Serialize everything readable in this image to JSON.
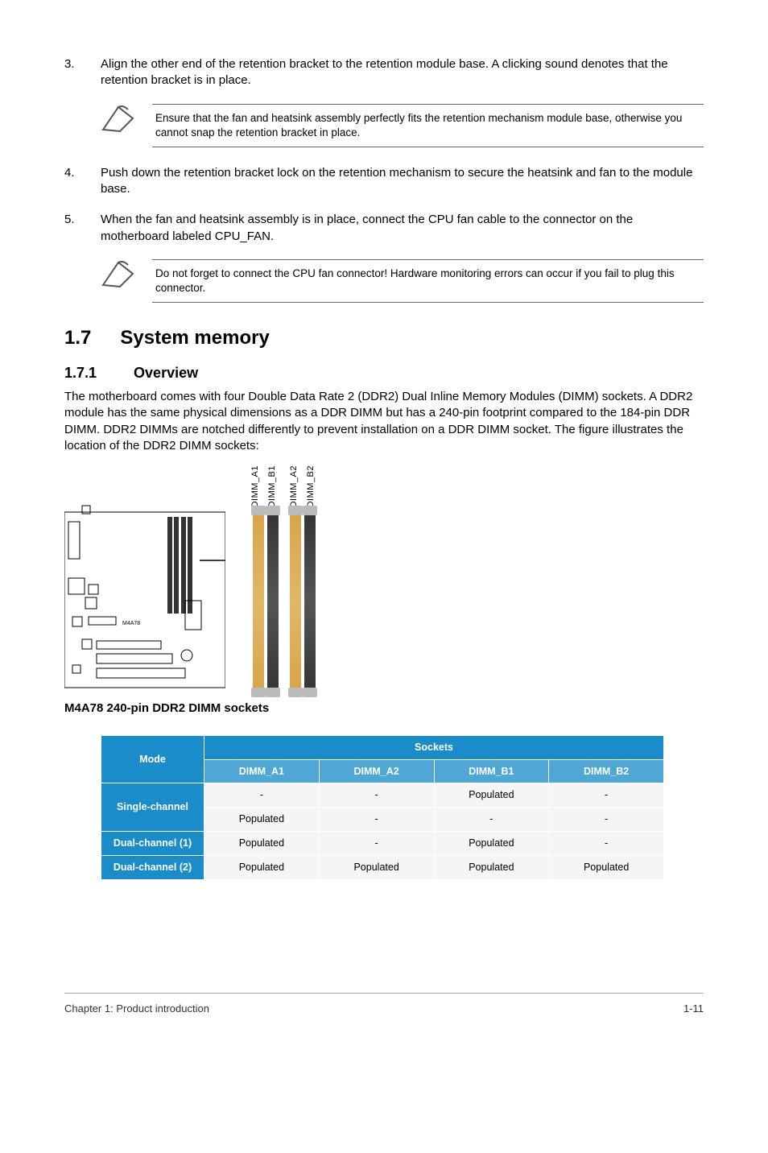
{
  "steps": {
    "s3": {
      "num": "3.",
      "text": "Align the other end of the retention bracket to the retention module base. A clicking sound denotes that the retention bracket is in place."
    },
    "s4": {
      "num": "4.",
      "text": "Push down the retention bracket lock on the retention mechanism to secure the heatsink and fan to the module base."
    },
    "s5": {
      "num": "5.",
      "text": "When the fan and heatsink assembly is in place, connect the CPU fan cable to the connector on the motherboard labeled CPU_FAN."
    }
  },
  "notes": {
    "n1": "Ensure that the fan and heatsink assembly perfectly fits the retention mechanism module base, otherwise you cannot snap the retention bracket  in place.",
    "n2": "Do not forget to connect the CPU fan connector! Hardware monitoring errors can occur if you fail to plug this connector."
  },
  "section": {
    "num": "1.7",
    "title": "System memory"
  },
  "subsection": {
    "num": "1.7.1",
    "title": "Overview"
  },
  "overview_body": "The motherboard comes with four Double Data Rate 2 (DDR2) Dual Inline Memory Modules (DIMM) sockets. A DDR2 module has the same physical dimensions as a DDR DIMM but has a 240-pin footprint compared to the 184-pin DDR DIMM. DDR2 DIMMs are notched differently to prevent installation on a DDR DIMM socket. The figure illustrates the location of the DDR2 DIMM sockets:",
  "dimm_labels": [
    "DIMM_A1",
    "DIMM_B1",
    "DIMM_A2",
    "DIMM_B2"
  ],
  "diagram_caption": "M4A78 240-pin DDR2 DIMM sockets",
  "table": {
    "mode_header": "Mode",
    "sockets_header": "Sockets",
    "cols": [
      "DIMM_A1",
      "DIMM_A2",
      "DIMM_B1",
      "DIMM_B2"
    ],
    "rows": [
      {
        "label": "Single-channel",
        "rowspan": 2,
        "cells": [
          "-",
          "-",
          "Populated",
          "-"
        ]
      },
      {
        "label": "",
        "cells": [
          "Populated",
          "-",
          "-",
          "-"
        ]
      },
      {
        "label": "Dual-channel (1)",
        "cells": [
          "Populated",
          "-",
          "Populated",
          "-"
        ]
      },
      {
        "label": "Dual-channel (2)",
        "cells": [
          "Populated",
          "Populated",
          "Populated",
          "Populated"
        ]
      }
    ]
  },
  "footer": {
    "left": "Chapter 1: Product introduction",
    "right": "1-11"
  }
}
